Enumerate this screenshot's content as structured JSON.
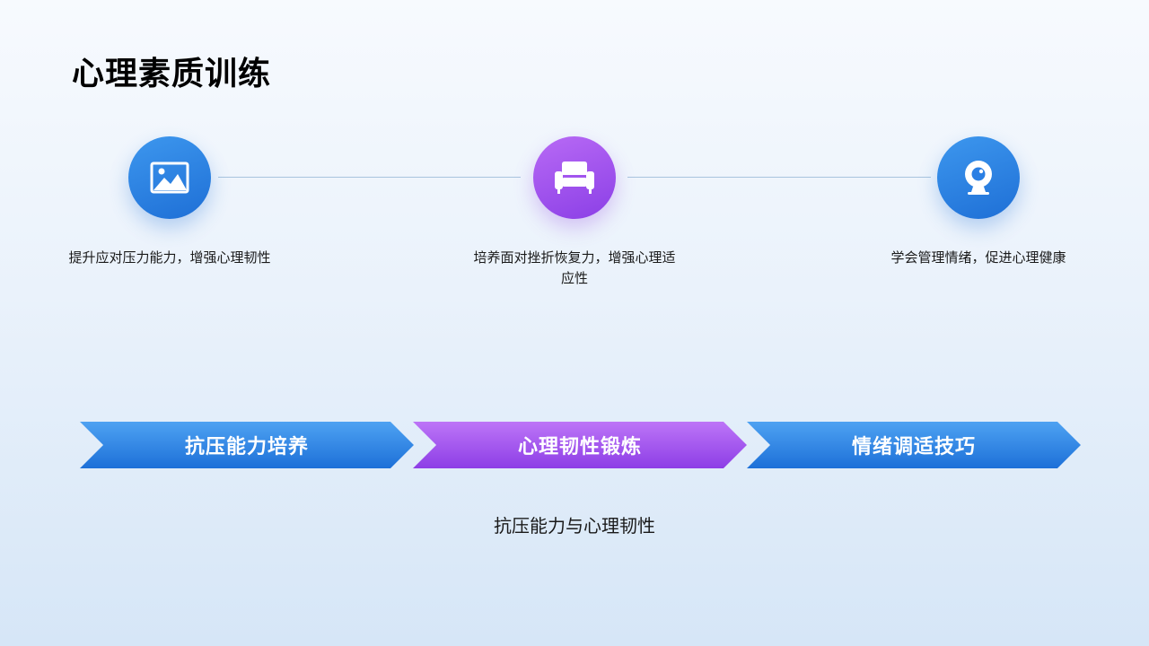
{
  "slide": {
    "title": "心理素质训练",
    "caption": "抗压能力与心理韧性"
  },
  "steps": [
    {
      "icon": "image-icon",
      "color": "#2a7fe4",
      "description": "提升应对压力能力，增强心理韧性",
      "label": "抗压能力培养"
    },
    {
      "icon": "armchair-icon",
      "color": "#9b4dec",
      "description": "培养面对挫折恢复力，增强心理适应性",
      "label": "心理韧性锻炼"
    },
    {
      "icon": "webcam-icon",
      "color": "#2a7fe4",
      "description": "学会管理情绪，促进心理健康",
      "label": "情绪调适技巧"
    }
  ]
}
